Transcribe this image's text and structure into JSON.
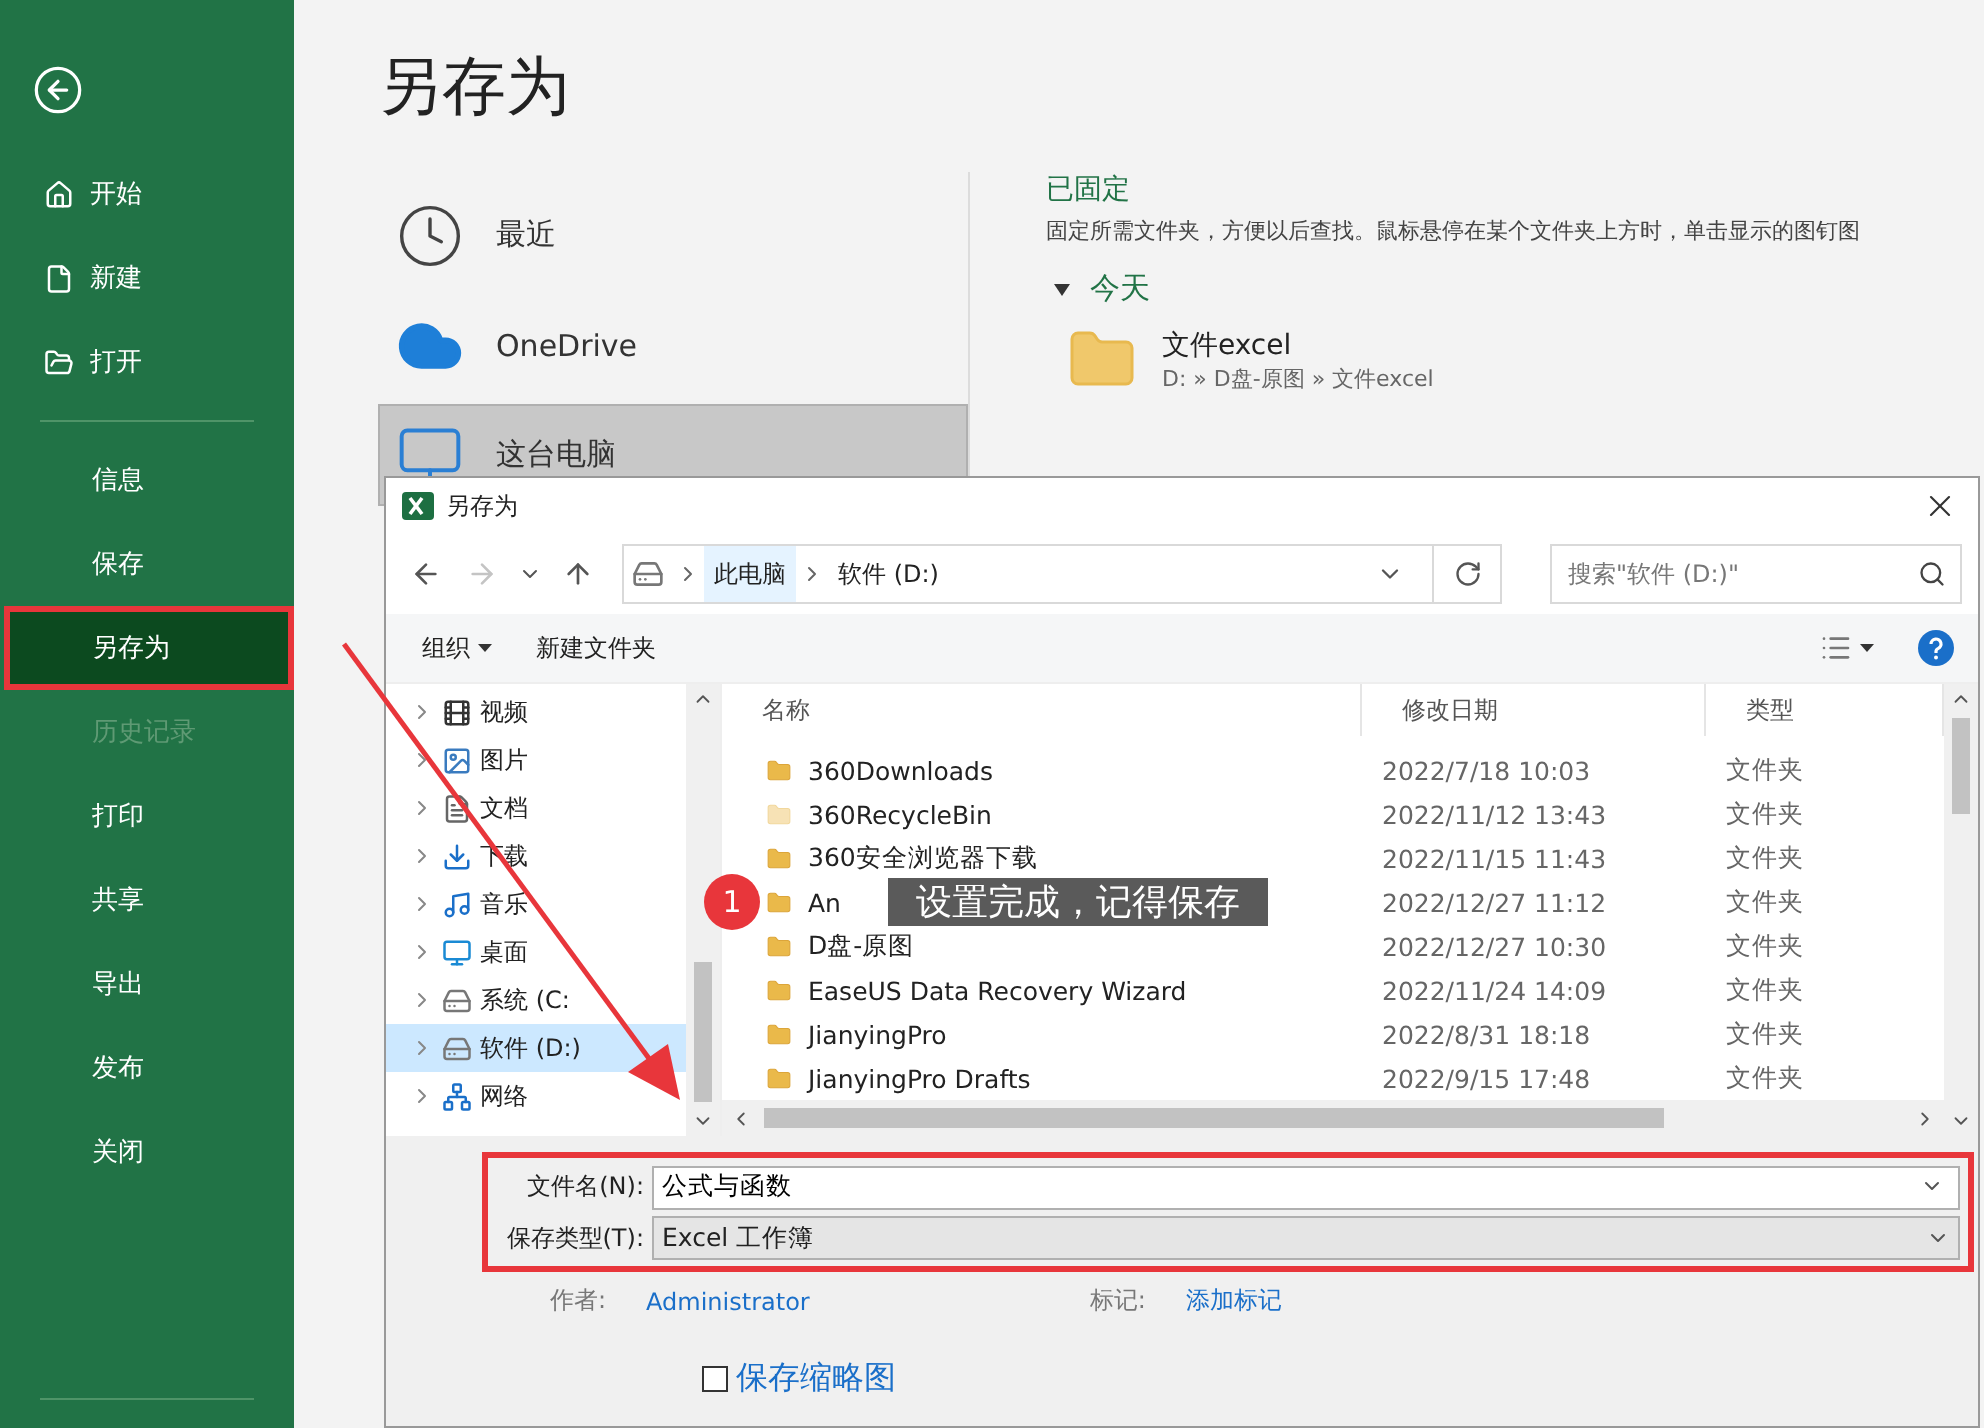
{
  "sidebar": {
    "items": [
      {
        "label": "开始",
        "kind": "home",
        "selected": false,
        "disabled": false
      },
      {
        "label": "新建",
        "kind": "new",
        "selected": false,
        "disabled": false
      },
      {
        "label": "打开",
        "kind": "open",
        "selected": false,
        "disabled": false
      },
      {
        "label": "信息",
        "kind": "plain",
        "selected": false,
        "disabled": false
      },
      {
        "label": "保存",
        "kind": "plain",
        "selected": false,
        "disabled": false
      },
      {
        "label": "另存为",
        "kind": "plain",
        "selected": true,
        "disabled": false
      },
      {
        "label": "历史记录",
        "kind": "plain",
        "selected": false,
        "disabled": true
      },
      {
        "label": "打印",
        "kind": "plain",
        "selected": false,
        "disabled": false
      },
      {
        "label": "共享",
        "kind": "plain",
        "selected": false,
        "disabled": false
      },
      {
        "label": "导出",
        "kind": "plain",
        "selected": false,
        "disabled": false
      },
      {
        "label": "发布",
        "kind": "plain",
        "selected": false,
        "disabled": false
      },
      {
        "label": "关闭",
        "kind": "plain",
        "selected": false,
        "disabled": false
      }
    ]
  },
  "page": {
    "title": "另存为"
  },
  "locations": [
    {
      "label": "最近",
      "kind": "recent",
      "selected": false
    },
    {
      "label": "OneDrive",
      "kind": "cloud",
      "selected": false
    },
    {
      "label": "这台电脑",
      "kind": "pc",
      "selected": true
    }
  ],
  "pinned": {
    "heading": "已固定",
    "description": "固定所需文件夹，方便以后查找。鼠标悬停在某个文件夹上方时，单击显示的图钉图",
    "group": {
      "label": "今天",
      "expanded": true
    },
    "folders": [
      {
        "name": "文件excel",
        "path": "D: » D盘-原图 » 文件excel"
      }
    ]
  },
  "dialog": {
    "title": "另存为",
    "nav_buttons": [
      {
        "kind": "back",
        "disabled": false
      },
      {
        "kind": "forward",
        "disabled": true
      },
      {
        "kind": "recent",
        "disabled": false
      },
      {
        "kind": "up",
        "disabled": false
      }
    ],
    "address": [
      {
        "label": "此电脑",
        "selected": true
      },
      {
        "label": "软件 (D:)",
        "selected": false
      }
    ],
    "search": {
      "placeholder": "搜索\"软件 (D:)\""
    },
    "toolbar": {
      "organize": "组织",
      "new_folder": "新建文件夹"
    },
    "nav": [
      {
        "label": "视频",
        "kind": "video",
        "selected": false
      },
      {
        "label": "图片",
        "kind": "pictures",
        "selected": false
      },
      {
        "label": "文档",
        "kind": "docs",
        "selected": false
      },
      {
        "label": "下载",
        "kind": "download",
        "selected": false
      },
      {
        "label": "音乐",
        "kind": "music",
        "selected": false
      },
      {
        "label": "桌面",
        "kind": "desktop",
        "selected": false
      },
      {
        "label": "系统 (C:",
        "kind": "drive",
        "selected": false
      },
      {
        "label": "软件 (D:)",
        "kind": "drive",
        "selected": true
      },
      {
        "label": "网络",
        "kind": "network",
        "selected": false
      }
    ],
    "columns": [
      "名称",
      "修改日期",
      "类型"
    ],
    "rows": [
      {
        "name": "360Downloads",
        "modified": "2022/7/18 10:03",
        "type": "文件夹",
        "hidden": false
      },
      {
        "name": "360RecycleBin",
        "modified": "2022/11/12 13:43",
        "type": "文件夹",
        "hidden": true
      },
      {
        "name": "360安全浏览器下载",
        "modified": "2022/11/15 11:43",
        "type": "文件夹",
        "hidden": false
      },
      {
        "name": "An",
        "modified": "2022/12/27 11:12",
        "type": "文件夹",
        "hidden": false
      },
      {
        "name": "D盘-原图",
        "modified": "2022/12/27 10:30",
        "type": "文件夹",
        "hidden": false
      },
      {
        "name": "EaseUS Data Recovery Wizard",
        "modified": "2022/11/24 14:09",
        "type": "文件夹",
        "hidden": false
      },
      {
        "name": "JianyingPro",
        "modified": "2022/8/31 18:18",
        "type": "文件夹",
        "hidden": false
      },
      {
        "name": "JianyingPro Drafts",
        "modified": "2022/9/15 17:48",
        "type": "文件夹",
        "hidden": false
      }
    ],
    "form": {
      "filename_label": "文件名(N):",
      "filename": "公式与函数",
      "type_label": "保存类型(T):",
      "type": "Excel 工作簿",
      "author_label": "作者:",
      "author": "Administrator",
      "tags_label": "标记:",
      "tags": "添加标记",
      "thumbnail": {
        "label": "保存缩略图",
        "checked": false
      }
    }
  },
  "annotation": {
    "badge": "1",
    "text": "设置完成，记得保存"
  }
}
